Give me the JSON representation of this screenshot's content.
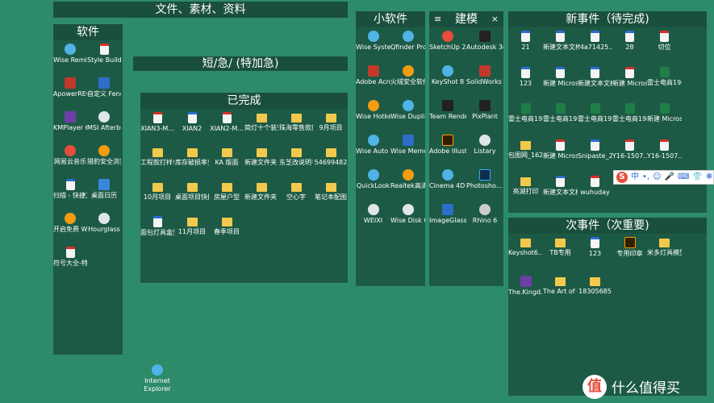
{
  "fences": {
    "files_title": "文件、素材、资料",
    "software_title": "软件",
    "urgent_title": "短/急/ (特加急)",
    "done_title": "已完成",
    "small_title": "小软件",
    "modeling_title": "建模",
    "new_events_title": "新事件（待完成)",
    "secondary_title": "次事件（次重要)"
  },
  "software": [
    {
      "label": "Wise Reminder",
      "icon": "clock-icon"
    },
    {
      "label": "Style Build...",
      "icon": "style-icon"
    },
    {
      "label": "ApowerREC",
      "icon": "record-icon"
    },
    {
      "label": "自定义 Fences",
      "icon": "fences-icon"
    },
    {
      "label": "KMPlayer 64X",
      "icon": "player-icon"
    },
    {
      "label": "MSI Afterburner",
      "icon": "afterburner-icon"
    },
    {
      "label": "网易云音乐",
      "icon": "music-icon"
    },
    {
      "label": "猎豹安全浏览器",
      "icon": "browser-icon"
    },
    {
      "label": "扫描 - 快捷方式",
      "icon": "scan-icon"
    },
    {
      "label": "桌面日历",
      "icon": "calendar-icon"
    },
    {
      "label": "开启免费 WiFi",
      "icon": "wifi-icon"
    },
    {
      "label": "Hourglass",
      "icon": "hourglass-icon"
    },
    {
      "label": "符号大全-特殊符号-特...",
      "icon": "doc-icon"
    }
  ],
  "done": [
    {
      "label": "XIAN3-M...",
      "icon": "pdf-icon"
    },
    {
      "label": "XIAN2",
      "icon": "image-icon"
    },
    {
      "label": "XIAN2-M...",
      "icon": "pdf-icon"
    },
    {
      "label": "简灯十个装变更",
      "icon": "folder-icon"
    },
    {
      "label": "珠海零售款打样单",
      "icon": "folder-icon"
    },
    {
      "label": "9月项目",
      "icon": "folder-icon"
    },
    {
      "label": "工程款打样单",
      "icon": "folder-icon"
    },
    {
      "label": "库存破损率变更",
      "icon": "folder-icon"
    },
    {
      "label": "KA 版面",
      "icon": "folder-icon"
    },
    {
      "label": "新建文件夹 (4)",
      "icon": "folder-icon"
    },
    {
      "label": "东芝改说明书",
      "icon": "folder-icon"
    },
    {
      "label": "54699482",
      "icon": "folder-icon"
    },
    {
      "label": "10月项目",
      "icon": "folder-icon"
    },
    {
      "label": "桌面项目快捷方式",
      "icon": "folder-icon"
    },
    {
      "label": "房屋户型",
      "icon": "folder-icon"
    },
    {
      "label": "新建文件夹 (12)",
      "icon": "folder-icon"
    },
    {
      "label": "空心字",
      "icon": "folder-icon"
    },
    {
      "label": "笔记本配图",
      "icon": "folder-icon"
    },
    {
      "label": "面包灯具盒型适配专用",
      "icon": "image-icon"
    },
    {
      "label": "11月项目",
      "icon": "folder-icon"
    },
    {
      "label": "春季项目",
      "icon": "folder-icon"
    }
  ],
  "small": [
    {
      "label": "Wise Syste...",
      "icon": "wise-icon"
    },
    {
      "label": "Qfinder Pro",
      "icon": "qfinder-icon"
    },
    {
      "label": "Adobe Acrobat DC",
      "icon": "acrobat-icon"
    },
    {
      "label": "火绒安全软件",
      "icon": "shield-icon"
    },
    {
      "label": "Wise Hotkey",
      "icon": "hotkey-icon"
    },
    {
      "label": "Wise Duplica...",
      "icon": "duplicate-icon"
    },
    {
      "label": "Wise Auto Shutdown",
      "icon": "shutdown-icon"
    },
    {
      "label": "Wise Memor...",
      "icon": "memory-icon"
    },
    {
      "label": "QuickLook",
      "icon": "quicklook-icon"
    },
    {
      "label": "Realtek高清晰音频管...",
      "icon": "audio-icon"
    },
    {
      "label": "WEIXI",
      "icon": "wechat-icon"
    },
    {
      "label": "Wise Disk Cleaner",
      "icon": "disk-icon"
    }
  ],
  "modeling": {
    "menu_icon": "≡",
    "close_icon": "×",
    "items": [
      {
        "label": "SketchUp 2016",
        "icon": "sketchup-icon"
      },
      {
        "label": "Autodesk 3ds Max ...",
        "icon": "3dsmax-icon"
      },
      {
        "label": "KeyShot 8",
        "icon": "keyshot-icon"
      },
      {
        "label": "SolidWorks 2014 x64 ...",
        "icon": "solidworks-icon"
      },
      {
        "label": "Team Render S...",
        "icon": "teamrender-icon"
      },
      {
        "label": "PixPlant",
        "icon": "pixplant-icon"
      },
      {
        "label": "Adobe Illustrat...",
        "icon": "illustrator-icon"
      },
      {
        "label": "Listary",
        "icon": "listary-icon"
      },
      {
        "label": "Cinema 4D R20",
        "icon": "cinema4d-icon"
      },
      {
        "label": "Photosho... - 快捷方式",
        "icon": "photoshop-icon"
      },
      {
        "label": "ImageGlass",
        "icon": "imageglass-icon"
      },
      {
        "label": "Rhino 6",
        "icon": "rhino-icon"
      }
    ]
  },
  "new_events": [
    {
      "label": "21",
      "icon": "image-icon"
    },
    {
      "label": "新建文本文档 (2)",
      "icon": "txt-icon"
    },
    {
      "label": "f4a71425...",
      "icon": "image-icon"
    },
    {
      "label": "28",
      "icon": "image-icon"
    },
    {
      "label": "切位",
      "icon": "pdf-icon"
    },
    {
      "label": "123",
      "icon": "image-icon"
    },
    {
      "label": "新建 Microsoft...",
      "icon": "txt-icon"
    },
    {
      "label": "新建文本文档 (3)",
      "icon": "txt-icon"
    },
    {
      "label": "新建 Microsoft...",
      "icon": "pdf-icon"
    },
    {
      "label": "雷士电商19年11月技...",
      "icon": "excel-icon"
    },
    {
      "label": "雷士电商19年11月技...",
      "icon": "excel-icon"
    },
    {
      "label": "雷士电商19年11月技...",
      "icon": "excel-icon"
    },
    {
      "label": "雷士电商19年11月技...",
      "icon": "excel-icon"
    },
    {
      "label": "雷士电商19年11月技...",
      "icon": "excel-icon"
    },
    {
      "label": "新建 Microsoft...",
      "icon": "excel-icon"
    },
    {
      "label": "包图网_162389大...",
      "icon": "folder-icon"
    },
    {
      "label": "新建 Microsoft...",
      "icon": "pdf-icon"
    },
    {
      "label": "Snipaste_2...",
      "icon": "image-icon"
    },
    {
      "label": "Y16-1507...",
      "icon": "pdf-icon"
    },
    {
      "label": "Y16-1507...",
      "icon": "pdf-icon"
    },
    {
      "label": "亮湖打印",
      "icon": "folder-icon"
    },
    {
      "label": "新建文本文档 (4)",
      "icon": "txt-icon"
    },
    {
      "label": "wuhuday",
      "icon": "pdf-icon"
    }
  ],
  "secondary": [
    {
      "label": "Keyshot6...",
      "icon": "folder-icon"
    },
    {
      "label": "TB专用",
      "icon": "folder-icon"
    },
    {
      "label": "123",
      "icon": "image-icon"
    },
    {
      "label": "专用印章",
      "icon": "ai-icon"
    },
    {
      "label": "米多灯具模型",
      "icon": "folder-icon"
    },
    {
      "label": "The.Kingd...",
      "icon": "video-icon"
    },
    {
      "label": "The Art of Dishonor...",
      "icon": "folder-icon"
    },
    {
      "label": "18305685",
      "icon": "folder-icon"
    }
  ],
  "desktop": {
    "ie_label": "Internet Explorer"
  },
  "ime": {
    "logo": "S",
    "mode": "中",
    "items": [
      "•,",
      "☺",
      "🎤",
      "⌨",
      "👕",
      "❋"
    ]
  },
  "watermark": {
    "logo": "值",
    "text": "什么值得买"
  }
}
